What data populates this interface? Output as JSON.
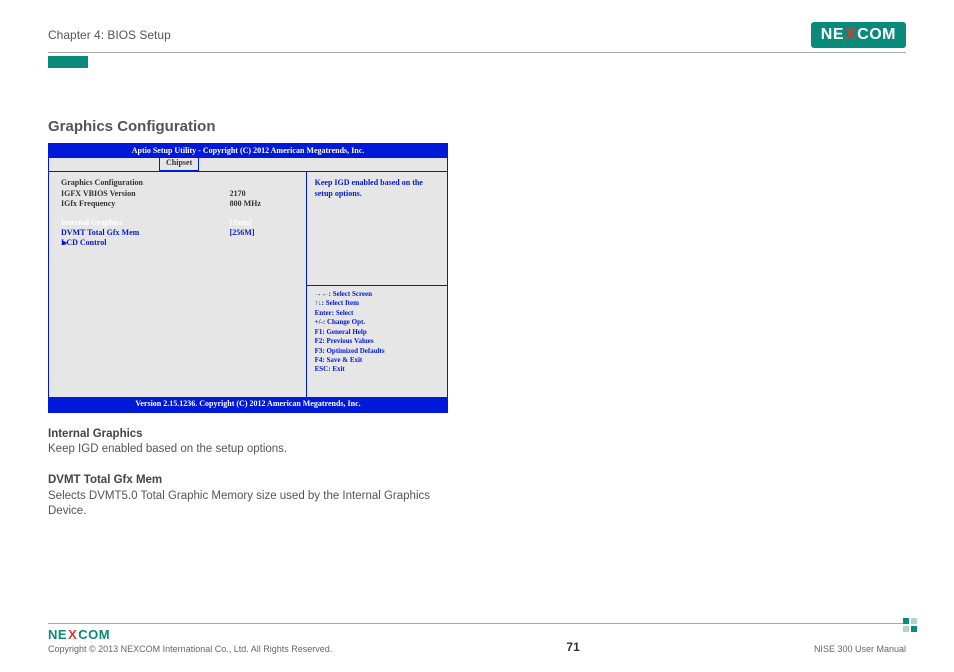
{
  "header": {
    "chapter": "Chapter 4: BIOS Setup",
    "logo_pre": "NE",
    "logo_x": "X",
    "logo_post": "COM"
  },
  "section_title": "Graphics Configuration",
  "bios": {
    "top_bar": "Aptio Setup Utility - Copyright (C) 2012 American Megatrends, Inc.",
    "tab": "Chipset",
    "rows": {
      "title": "Graphics Configuration",
      "r1_label": "IGFX VBIOS Version",
      "r1_value": "2170",
      "r2_label": "IGfx Frequency",
      "r2_value": "800 MHz",
      "r3_label": "Internal Graphics",
      "r3_value": "[Auto]",
      "r4_label": "DVMT Total Gfx Mem",
      "r4_value": "[256M]",
      "r5_label": "LCD Control"
    },
    "help_text": "Keep IGD enabled based on the setup options.",
    "keys": {
      "k1": "→←: Select Screen",
      "k2": "↑↓: Select Item",
      "k3": "Enter: Select",
      "k4": "+/-: Change Opt.",
      "k5": "F1: General Help",
      "k6": "F2: Previous Values",
      "k7": "F3: Optimized Defaults",
      "k8": "F4: Save & Exit",
      "k9": "ESC: Exit"
    },
    "bottom_bar": "Version 2.15.1236. Copyright (C) 2012 American Megatrends, Inc."
  },
  "descriptions": {
    "d1_title": "Internal Graphics",
    "d1_body": "Keep IGD enabled based on the setup options.",
    "d2_title": "DVMT Total Gfx Mem",
    "d2_body": "Selects DVMT5.0 Total Graphic Memory size used by the Internal Graphics Device."
  },
  "footer": {
    "copyright": "Copyright © 2013 NEXCOM International Co., Ltd. All Rights Reserved.",
    "page_number": "71",
    "manual": "NISE 300 User Manual"
  }
}
